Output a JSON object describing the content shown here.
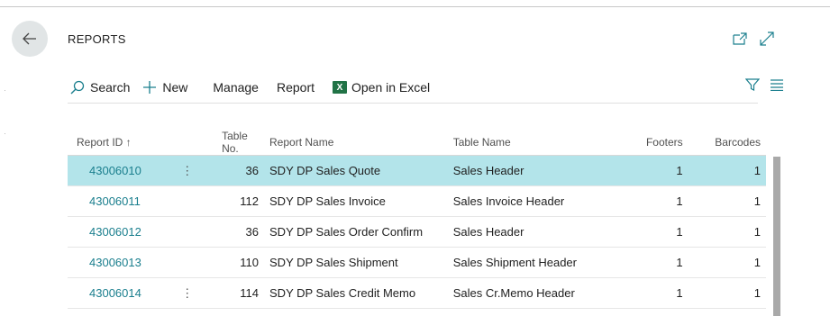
{
  "page": {
    "title": "REPORTS"
  },
  "actions": {
    "search": "Search",
    "new": "New",
    "manage": "Manage",
    "report": "Report",
    "excel_icon": "X",
    "open_in_excel": "Open in Excel"
  },
  "table": {
    "headers": {
      "report_id": "Report ID ↑",
      "table_no": "Table No.",
      "report_name": "Report Name",
      "table_name": "Table Name",
      "footers": "Footers",
      "barcodes": "Barcodes"
    },
    "rows": [
      {
        "report_id": "43006010",
        "table_no": "36",
        "report_name": "SDY DP Sales Quote",
        "table_name": "Sales Header",
        "footers": "1",
        "barcodes": "1",
        "dots": "⋮"
      },
      {
        "report_id": "43006011",
        "table_no": "112",
        "report_name": "SDY DP Sales Invoice",
        "table_name": "Sales Invoice Header",
        "footers": "1",
        "barcodes": "1",
        "dots": ""
      },
      {
        "report_id": "43006012",
        "table_no": "36",
        "report_name": "SDY DP Sales Order Confirm",
        "table_name": "Sales Header",
        "footers": "1",
        "barcodes": "1",
        "dots": ""
      },
      {
        "report_id": "43006013",
        "table_no": "110",
        "report_name": "SDY DP Sales Shipment",
        "table_name": "Sales Shipment Header",
        "footers": "1",
        "barcodes": "1",
        "dots": ""
      },
      {
        "report_id": "43006014",
        "table_no": "114",
        "report_name": "SDY DP Sales Credit Memo",
        "table_name": "Sales Cr.Memo Header",
        "footers": "1",
        "barcodes": "1",
        "dots": "⋮"
      }
    ]
  },
  "colors": {
    "accent": "#1b7f8e",
    "selected_row": "#b3e4ea",
    "excel": "#217346"
  },
  "icons": [
    "back-arrow-icon",
    "open-in-new-window-icon",
    "expand-icon",
    "search-icon",
    "plus-icon",
    "excel-icon",
    "filter-icon",
    "list-view-icon",
    "more-options-icon"
  ]
}
